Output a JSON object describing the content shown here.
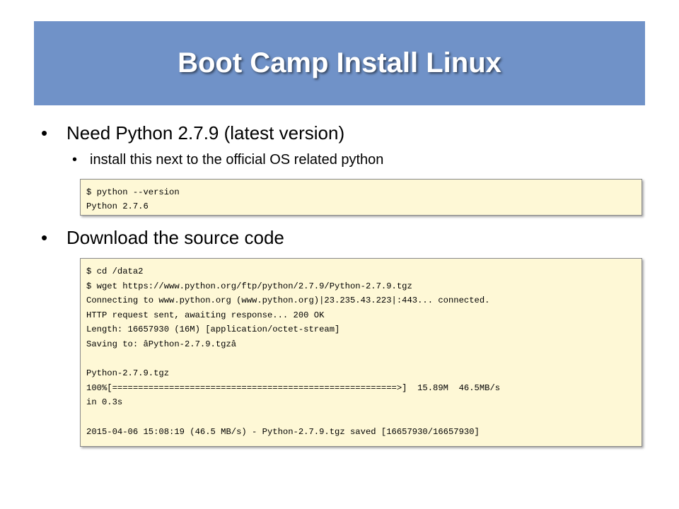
{
  "slide": {
    "title": "Boot Camp Install Linux",
    "bullets": [
      {
        "level": 1,
        "text": "Need Python 2.7.9 (latest version)"
      },
      {
        "level": 2,
        "text": "install this next to the official OS related python"
      },
      {
        "level": 1,
        "text": "Download the source code"
      }
    ],
    "bullet_glyph": "•",
    "code_blocks": [
      {
        "lines": [
          "$ python --version",
          "Python 2.7.6"
        ]
      },
      {
        "lines": [
          "$ cd /data2",
          "$ wget https://www.python.org/ftp/python/2.7.9/Python-2.7.9.tgz",
          "Connecting to www.python.org (www.python.org)|23.235.43.223|:443... connected.",
          "HTTP request sent, awaiting response... 200 OK",
          "Length: 16657930 (16M) [application/octet-stream]",
          "Saving to: âPython-2.7.9.tgzâ",
          "",
          "Python-2.7.9.tgz",
          "100%[=======================================================>]  15.89M  46.5MB/s",
          "in 0.3s",
          "",
          "2015-04-06 15:08:19 (46.5 MB/s) - Python-2.7.9.tgz saved [16657930/16657930]"
        ]
      }
    ],
    "colors": {
      "title_banner": "#7092c8",
      "title_text": "#ffffff",
      "code_background": "#fef8d6"
    }
  }
}
